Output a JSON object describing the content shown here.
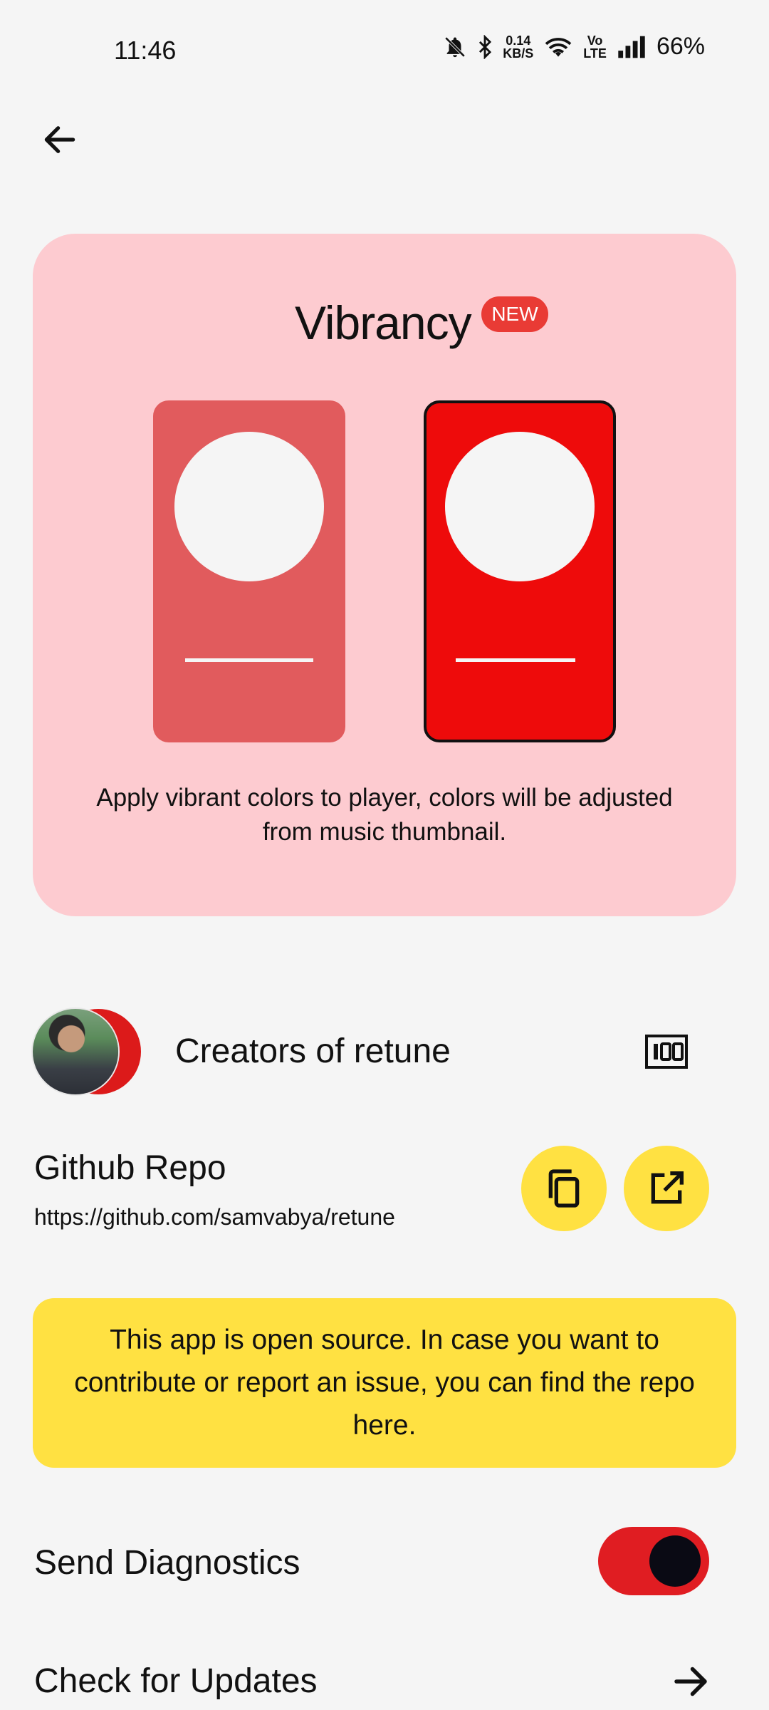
{
  "status_bar": {
    "time": "11:46",
    "net_speed_top": "0.14",
    "net_speed_bottom": "KB/S",
    "volte_top": "Vo",
    "volte_bottom": "LTE",
    "battery": "66%"
  },
  "vibrancy": {
    "title": "Vibrancy",
    "badge": "NEW",
    "description": "Apply vibrant colors to player, colors will be adjusted from music thumbnail.",
    "option_colors": [
      "#e15b5d",
      "#ee0b0b"
    ],
    "selected_index": 1
  },
  "creators": {
    "label": "Creators of retune"
  },
  "github": {
    "title": "Github Repo",
    "url": "https://github.com/samvabya/retune"
  },
  "info": {
    "text": "This app is open source. In case you want to contribute or report an issue, you can find the repo here."
  },
  "diagnostics": {
    "label": "Send Diagnostics",
    "enabled": true
  },
  "updates": {
    "label": "Check for Updates"
  },
  "colors": {
    "accent_yellow": "#ffe142",
    "accent_red": "#e01d22",
    "card_pink": "#fdcbd0",
    "background": "#f5f5f5"
  }
}
